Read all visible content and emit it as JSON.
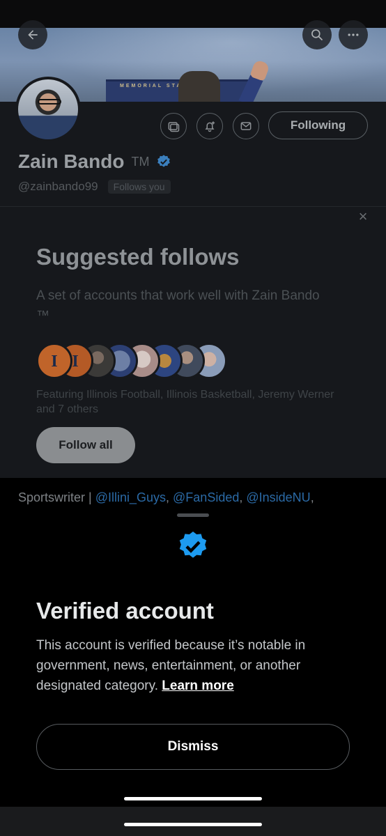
{
  "profile": {
    "name": "Zain Bando",
    "name_suffix": "TM",
    "handle": "@zainbando99",
    "follows_you": "Follows you",
    "following_label": "Following",
    "banner_text": "MEMORIAL STADIUM"
  },
  "icons": {
    "back": "back-arrow-icon",
    "search": "search-icon",
    "more": "more-icon",
    "media": "media-icon",
    "notify": "bell-plus-icon",
    "message": "envelope-icon",
    "verified": "verified-badge-icon",
    "close": "close-icon"
  },
  "suggested": {
    "title": "Suggested follows",
    "description": "A set of accounts that work well with Zain Bando ™",
    "featuring": "Featuring Illinois Football, Illinois Basketball, Jeremy Werner and 7 others",
    "follow_all": "Follow all"
  },
  "bio": {
    "prefix": "Sportswriter | ",
    "link1": "@Illini_Guys",
    "sep1": ", ",
    "link2": "@FanSided",
    "sep2": ", ",
    "link3": "@InsideNU",
    "suffix": ","
  },
  "sheet": {
    "title": "Verified account",
    "description": "This account is verified because it’s notable in government, news, entertainment, or another designated category. ",
    "learn_more": "Learn more",
    "dismiss": "Dismiss"
  },
  "colors": {
    "verified_blue": "#1d9bf0",
    "background": "#000000",
    "dimmed_surface": "#16181c"
  }
}
